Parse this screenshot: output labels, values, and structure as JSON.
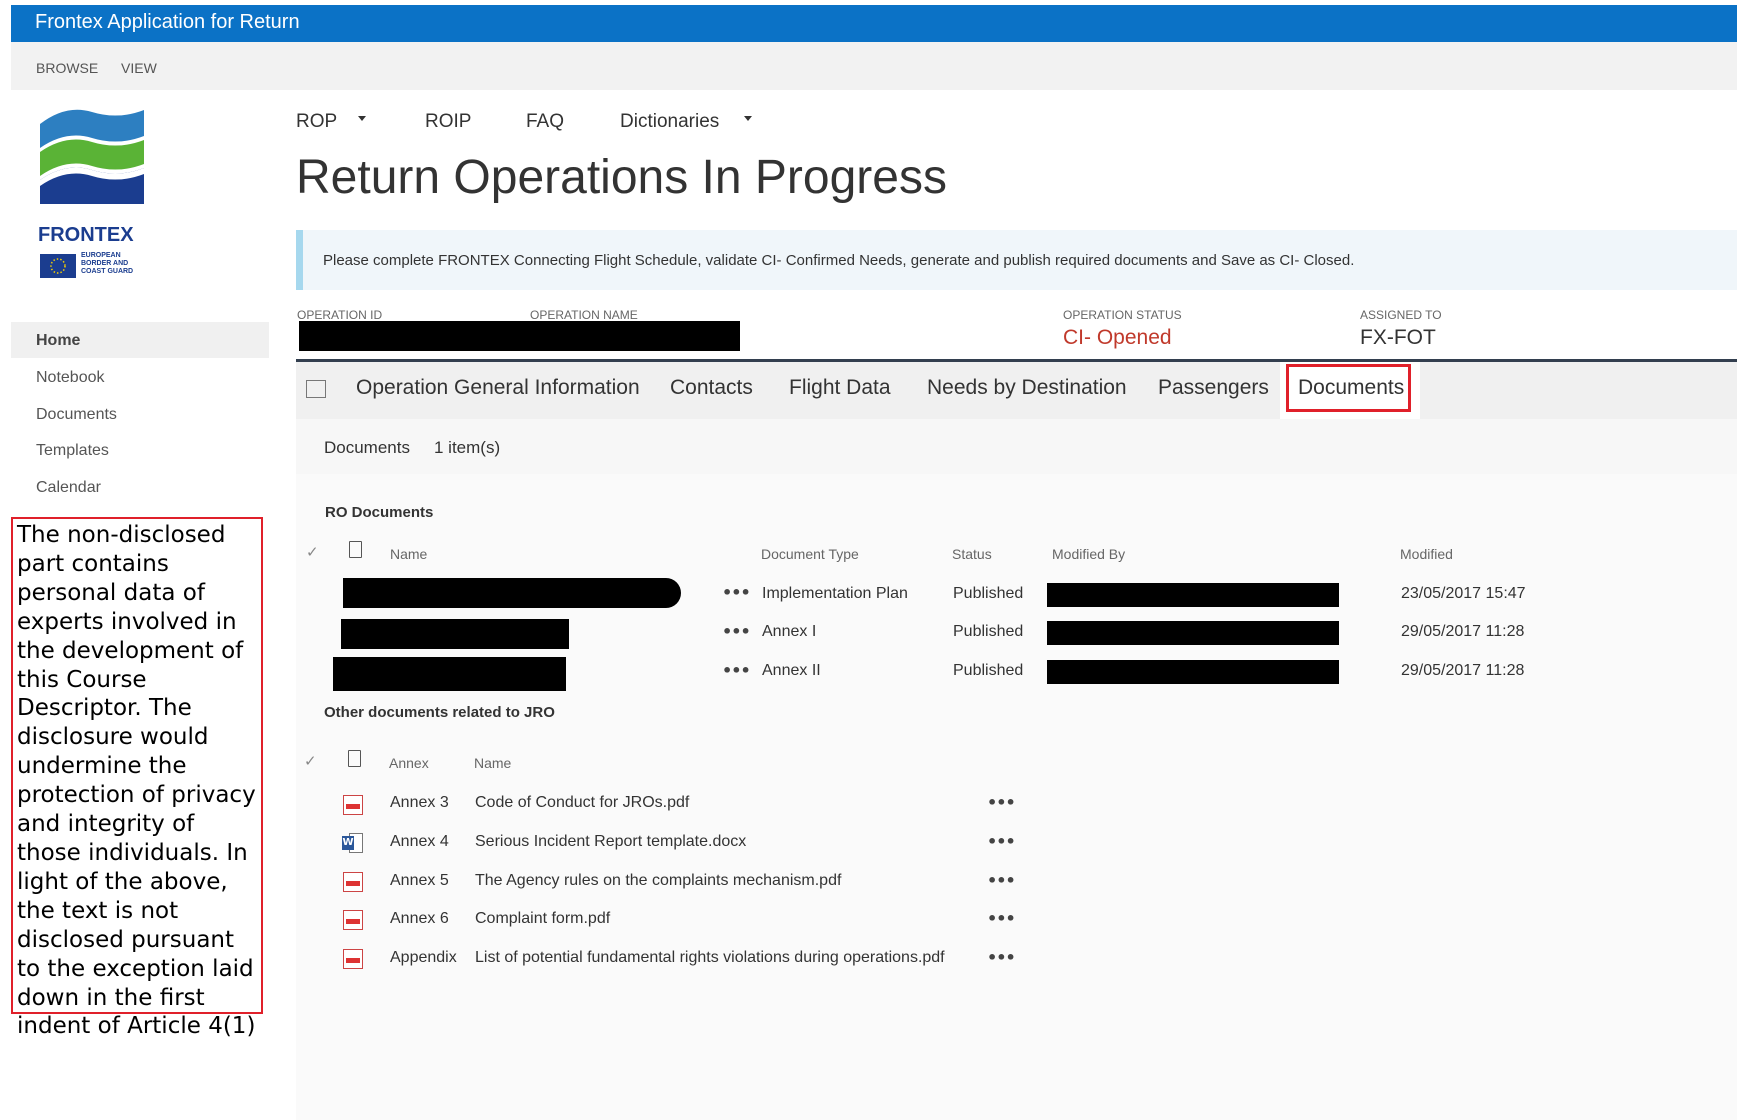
{
  "app_bar": {
    "title": "Frontex Application for Return"
  },
  "ribbon": {
    "browse": "BROWSE",
    "view": "VIEW"
  },
  "logo": {
    "brand": "FRONTEX",
    "tagline": "EUROPEAN BORDER AND COAST GUARD"
  },
  "top_nav": [
    {
      "label": "ROP",
      "has_dropdown": true
    },
    {
      "label": "ROIP",
      "has_dropdown": false
    },
    {
      "label": "FAQ",
      "has_dropdown": false
    },
    {
      "label": "Dictionaries",
      "has_dropdown": true
    }
  ],
  "page": {
    "title": "Return Operations In Progress"
  },
  "notice": "Please complete FRONTEX Connecting Flight Schedule, validate CI- Confirmed Needs, generate and publish required documents and Save as CI- Closed.",
  "operation": {
    "id_label": "OPERATION ID",
    "name_label": "OPERATION NAME",
    "status_label": "OPERATION STATUS",
    "status_value": "CI- Opened",
    "assigned_label": "ASSIGNED TO",
    "assigned_value": "FX-FOT",
    "status_color": "#c0392b"
  },
  "side_nav": [
    "Home",
    "Notebook",
    "Documents",
    "Templates",
    "Calendar"
  ],
  "tabs": [
    "Operation General Information",
    "Contacts",
    "Flight Data",
    "Needs by Destination",
    "Passengers",
    "Documents"
  ],
  "active_tab": "Documents",
  "doc_bar": {
    "label": "Documents",
    "count": "1 item(s)"
  },
  "ro_documents": {
    "heading": "RO Documents",
    "columns": {
      "name": "Name",
      "type": "Document Type",
      "status": "Status",
      "modified_by": "Modified By",
      "modified": "Modified"
    },
    "rows": [
      {
        "type": "Implementation Plan",
        "status": "Published",
        "modified": "23/05/2017 15:47"
      },
      {
        "type": "Annex I",
        "status": "Published",
        "modified": "29/05/2017 11:28"
      },
      {
        "type": "Annex II",
        "status": "Published",
        "modified": "29/05/2017 11:28"
      }
    ]
  },
  "other_documents": {
    "heading": "Other documents related to JRO",
    "columns": {
      "annex": "Annex",
      "name": "Name"
    },
    "rows": [
      {
        "icon": "pdf-icon",
        "annex": "Annex 3",
        "name": "Code of Conduct for JROs.pdf"
      },
      {
        "icon": "word-icon",
        "annex": "Annex 4",
        "name": "Serious Incident Report template.docx"
      },
      {
        "icon": "pdf-icon",
        "annex": "Annex 5",
        "name": "The Agency rules on the complaints mechanism.pdf"
      },
      {
        "icon": "pdf-icon",
        "annex": "Annex 6",
        "name": "Complaint form.pdf"
      },
      {
        "icon": "pdf-icon",
        "annex": "Appendix",
        "name": "List of potential fundamental rights violations during operations.pdf"
      }
    ]
  },
  "disclaimer": "The non-disclosed part contains personal data of experts involved in the development of this Course Descriptor. The disclosure would undermine the protection of privacy and integrity of those individuals. In light of the above, the text is not disclosed pursuant to the exception laid down in the first indent of Article 4(1)",
  "colors": {
    "app_bar": "#0b72c6",
    "highlight": "#e0202a",
    "notice_border": "#a6d8ee"
  }
}
